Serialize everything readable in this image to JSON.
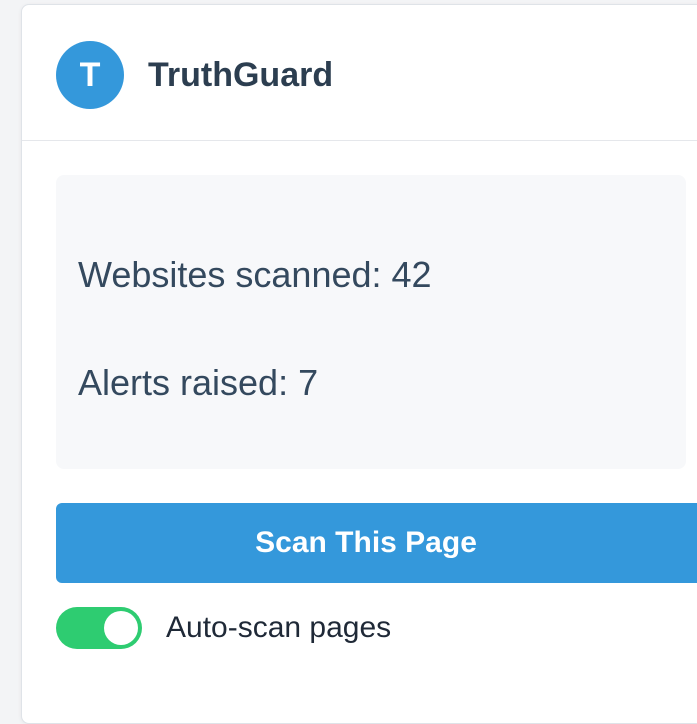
{
  "header": {
    "logo_letter": "T",
    "title": "TruthGuard"
  },
  "stats": {
    "websites_scanned": "Websites scanned: 42",
    "alerts_raised": "Alerts raised: 7"
  },
  "actions": {
    "scan_label": "Scan This Page"
  },
  "settings": {
    "auto_scan_label": "Auto-scan pages",
    "auto_scan_enabled": true
  },
  "colors": {
    "accent": "#3498db",
    "toggle_on": "#2ecc71"
  }
}
